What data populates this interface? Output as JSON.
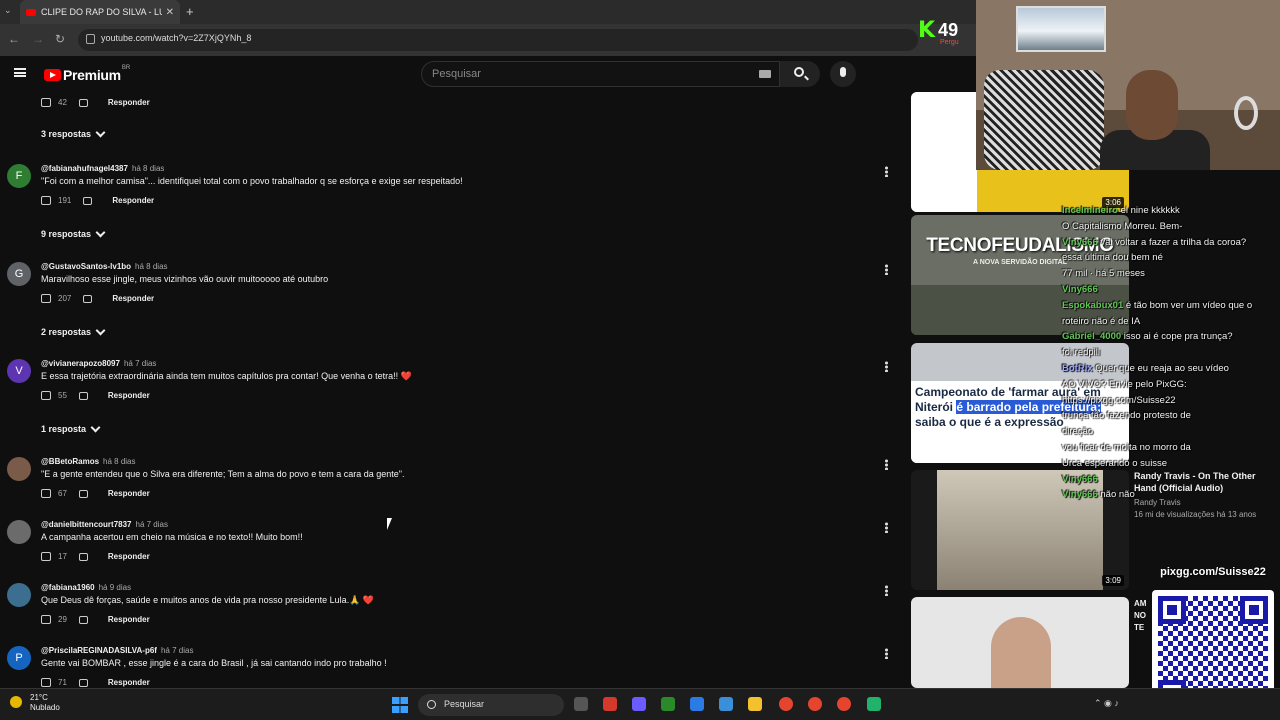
{
  "browser": {
    "tab_title": "CLIPE DO RAP DO SILVA - LULA",
    "url": "youtube.com/watch?v=2Z7XjQYNh_8"
  },
  "youtube": {
    "logo_text": "Premium",
    "region": "BR",
    "search_placeholder": "Pesquisar"
  },
  "top_actions": {
    "likes": "42",
    "reply": "Responder"
  },
  "comments": [
    {
      "avatar": "F",
      "avatar_color": "#2e7d32",
      "author": "@fabianahufnagel4387",
      "time": "há 8 dias",
      "text": "\"Foi com a melhor camisa\"... identifiquei total com o povo trabalhador q se esforça e exige ser respeitado!",
      "likes": "191",
      "reply": "Responder",
      "replies": "9 respostas"
    },
    {
      "avatar": "G",
      "avatar_color": "#5f6368",
      "author": "@GustavoSantos-lv1bo",
      "time": "há 8 dias",
      "text": "Maravilhoso esse jingle, meus vizinhos vão ouvir muitooooo até outubro",
      "likes": "207",
      "reply": "Responder",
      "replies": "2 respostas"
    },
    {
      "avatar": "V",
      "avatar_color": "#5e35b1",
      "author": "@vivianerapozo8097",
      "time": "há 7 dias",
      "text": "E essa trajetória extraordinária ainda tem muitos capítulos pra contar! Que venha o tetra!!",
      "heart": "❤️",
      "likes": "55",
      "reply": "Responder",
      "replies": "1 resposta"
    },
    {
      "avatar": "",
      "avatar_color": "#7a5a48",
      "author": "@BBetoRamos",
      "time": "há 8 dias",
      "text": "\"E a gente entendeu que o Silva era diferente; Tem a alma do povo e tem a cara da gente\".",
      "likes": "67",
      "reply": "Responder"
    },
    {
      "avatar": "",
      "avatar_color": "#6b6b6b",
      "author": "@danielbittencourt7837",
      "time": "há 7 dias",
      "text": "A campanha acertou em cheio na música e no texto!! Muito bom!!",
      "likes": "17",
      "reply": "Responder"
    },
    {
      "avatar": "",
      "avatar_color": "#3c6e8f",
      "author": "@fabiana1960",
      "time": "há 9 dias",
      "text": "Que Deus dê forças, saúde e muitos anos de vida pra nosso presidente Lula.🙏",
      "heart": "❤️",
      "likes": "29",
      "reply": "Responder"
    },
    {
      "avatar": "P",
      "avatar_color": "#1565c0",
      "author": "@PriscilaREGINADASILVA-p6f",
      "time": "há 7 dias",
      "text": "Gente vai BOMBAR , esse jingle é a cara do Brasil , já sai cantando indo pro trabalho !",
      "likes": "71",
      "reply": "Responder"
    }
  ],
  "first_replies": "3 respostas",
  "recommended": [
    {
      "duration": "3:06"
    },
    {
      "title": "TECNOFEUDALISMO",
      "subtitle": "A NOVA SERVIDÃO DIGITAL"
    },
    {
      "headline_a": "Campeonato de 'farmar aura' em Niterói",
      "headline_hl": "é barrado pela prefeitura;",
      "headline_b": "saiba o que é a expressão"
    },
    {
      "duration": "3:09",
      "title": "Randy Travis - On The Other Hand (Official Audio)",
      "channel": "Randy Travis",
      "meta": "16 mi de visualizações há 13 anos"
    },
    {
      "partial": "AM NO TE"
    }
  ],
  "overlay_chat": [
    {
      "user": "Incelmineiro",
      "msg": "el nine kkkkkk"
    },
    {
      "user": "",
      "msg": "O Capitalismo Morreu. Bem-"
    },
    {
      "user": "Viny666",
      "msg": "vai voltar a fazer a trilha da coroa?"
    },
    {
      "user": "",
      "msg": "essa última dou bem né"
    },
    {
      "user": "",
      "msg": "77 mil · há 5 meses"
    },
    {
      "user": "Viny666",
      "msg": ""
    },
    {
      "user": "Espokabux01",
      "msg": "é tão bom ver um vídeo que o"
    },
    {
      "user": "",
      "msg": "roteiro não é de IA"
    },
    {
      "user": "Gabriel_4000",
      "msg": "isso ai é cope pra trunça?"
    },
    {
      "user": "",
      "msg": "foi redpill"
    },
    {
      "user": "BotRix",
      "msg": "Quer que eu reaja ao seu vídeo"
    },
    {
      "user": "",
      "msg": "AO VIVO? Envie pelo PixGG:"
    },
    {
      "user": "",
      "msg": "https://pixgg.com/Suisse22"
    },
    {
      "user": "",
      "msg": "trunça tão fazendo protesto de"
    },
    {
      "user": "",
      "msg": "direção"
    },
    {
      "user": "",
      "msg": "vou ficar de moita no morro da"
    },
    {
      "user": "",
      "msg": "Urca esperando o suisse"
    },
    {
      "user": "Viny666",
      "msg": ""
    },
    {
      "user": "Viny666",
      "msg": "não não"
    }
  ],
  "kick": {
    "logo": "K",
    "viewers": "49",
    "label": "Pergu"
  },
  "pix": {
    "url": "pixgg.com/Suisse22"
  },
  "taskbar": {
    "temp": "21°C",
    "condition": "Nublado",
    "search": "Pesquisar"
  }
}
